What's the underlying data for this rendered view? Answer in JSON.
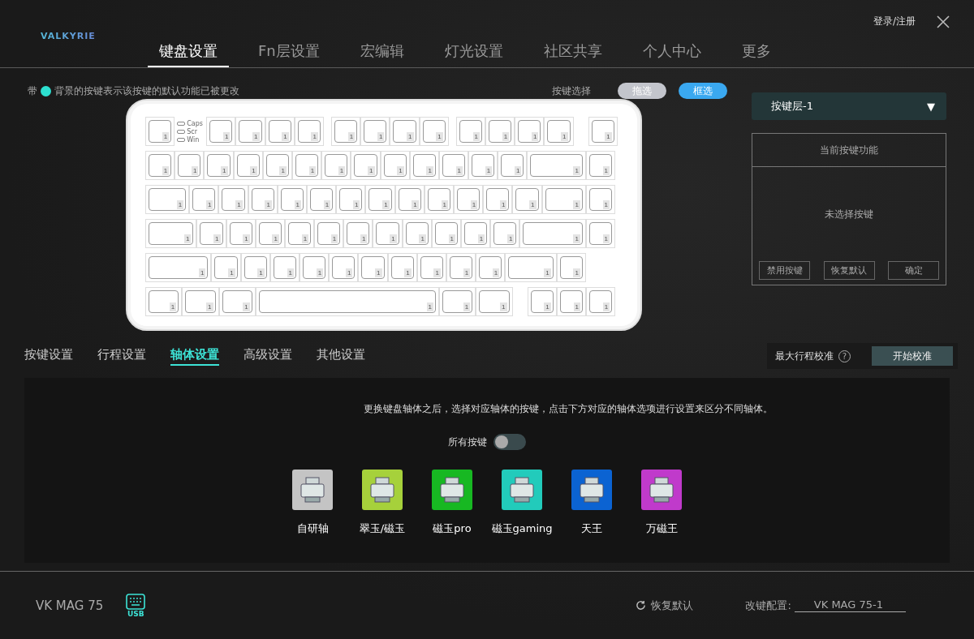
{
  "header": {
    "logo": "VALKYRIE",
    "login": "登录/注册"
  },
  "nav": [
    {
      "label": "键盘设置",
      "selected": true
    },
    {
      "label": "Fn层设置",
      "selected": false
    },
    {
      "label": "宏编辑",
      "selected": false
    },
    {
      "label": "灯光设置",
      "selected": false
    },
    {
      "label": "社区共享",
      "selected": false
    },
    {
      "label": "个人中心",
      "selected": false
    },
    {
      "label": "更多",
      "selected": false
    }
  ],
  "hint": {
    "prefix": "带",
    "text": "背景的按键表示该按键的默认功能已被更改",
    "color": "#2de0d0"
  },
  "key_select": {
    "label": "按键选择",
    "options": [
      {
        "label": "拖选",
        "selected": false
      },
      {
        "label": "框选",
        "selected": true
      }
    ]
  },
  "keyboard": {
    "leds": [
      "Caps",
      "Scr",
      "Win"
    ],
    "rows": [
      [
        "1",
        "1",
        "1",
        "1",
        "1",
        "1",
        "1",
        "1",
        "1",
        "1",
        "1",
        "1",
        "1",
        "1"
      ],
      [
        "1",
        "1",
        "1",
        "1",
        "1",
        "1",
        "1",
        "1",
        "1",
        "1",
        "1",
        "1",
        "1",
        "1",
        "1"
      ],
      [
        "1",
        "1",
        "1",
        "1",
        "1",
        "1",
        "1",
        "1",
        "1",
        "1",
        "1",
        "1",
        "1",
        "1",
        "1"
      ],
      [
        "1",
        "1",
        "1",
        "1",
        "1",
        "1",
        "1",
        "1",
        "1",
        "1",
        "1",
        "1",
        "1",
        "1"
      ],
      [
        "1",
        "1",
        "1",
        "1",
        "1",
        "1",
        "1",
        "1",
        "1",
        "1",
        "1",
        "1",
        "1"
      ],
      [
        "1",
        "1",
        "1",
        "1",
        "1",
        "1",
        "",
        "",
        "",
        "",
        "",
        "",
        "1",
        "1",
        "1"
      ]
    ]
  },
  "layer": {
    "value": "按键层-1",
    "caret": "▼"
  },
  "key_function": {
    "title": "当前按键功能",
    "empty": "未选择按键",
    "buttons": [
      "禁用按键",
      "恢复默认",
      "确定"
    ]
  },
  "sub_tabs": [
    {
      "label": "按键设置",
      "selected": false
    },
    {
      "label": "行程设置",
      "selected": false
    },
    {
      "label": "轴体设置",
      "selected": true
    },
    {
      "label": "高级设置",
      "selected": false
    },
    {
      "label": "其他设置",
      "selected": false
    }
  ],
  "calibration": {
    "label": "最大行程校准",
    "help": "?",
    "button": "开始校准"
  },
  "switch_panel": {
    "description": "更换键盘轴体之后，选择对应轴体的按键，点击下方对应的轴体选项进行设置来区分不同轴体。",
    "all_keys": {
      "label": "所有按键",
      "on": false
    },
    "switches": [
      {
        "name": "自研轴",
        "color": "#c4c4c4"
      },
      {
        "name": "翠玉/磁玉",
        "color": "#a6d13b"
      },
      {
        "name": "磁玉pro",
        "color": "#17b822"
      },
      {
        "name": "磁玉gaming",
        "color": "#22cbbb"
      },
      {
        "name": "天王",
        "color": "#0b63d2"
      },
      {
        "name": "万磁王",
        "color": "#c03acb"
      }
    ]
  },
  "footer": {
    "device": "VK MAG 75",
    "connection": "USB",
    "restore": "恢复默认",
    "config_label": "改键配置:",
    "config_value": "VK MAG 75-1"
  }
}
